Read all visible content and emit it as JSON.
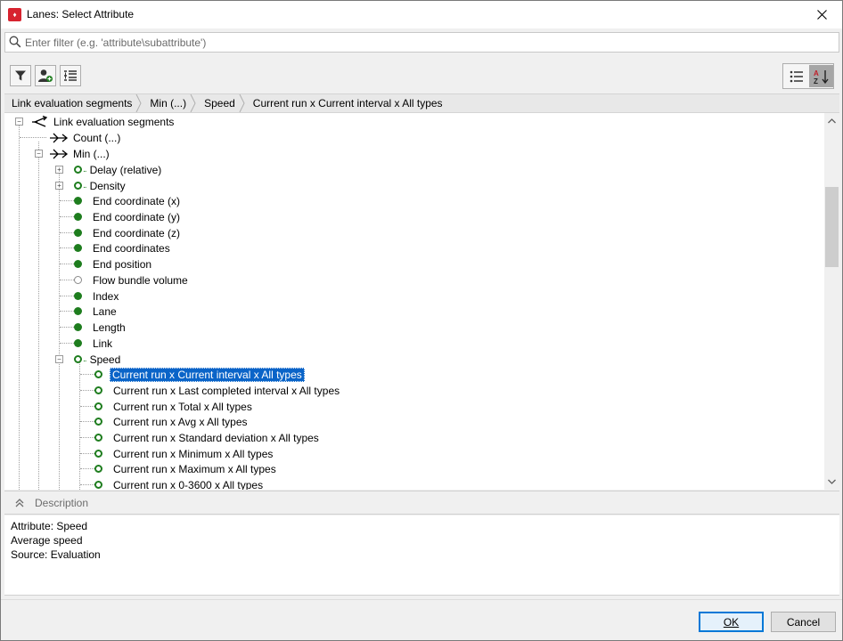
{
  "window": {
    "title": "Lanes: Select Attribute"
  },
  "filter": {
    "placeholder": "Enter filter (e.g. 'attribute\\subattribute')",
    "value": ""
  },
  "breadcrumb": [
    "Link evaluation segments",
    "Min (...)",
    "Speed",
    "Current run x Current interval x All types"
  ],
  "tree": {
    "root": "Link evaluation segments",
    "count": "Count (...)",
    "min": "Min (...)",
    "attributes": [
      {
        "label": "Delay (relative)",
        "icon": "ring-dots",
        "expandable": true
      },
      {
        "label": "Density",
        "icon": "ring-dots",
        "expandable": true
      },
      {
        "label": "End coordinate (x)",
        "icon": "filled"
      },
      {
        "label": "End coordinate (y)",
        "icon": "filled"
      },
      {
        "label": "End coordinate (z)",
        "icon": "filled"
      },
      {
        "label": "End coordinates",
        "icon": "filled"
      },
      {
        "label": "End position",
        "icon": "filled"
      },
      {
        "label": "Flow bundle volume",
        "icon": "ring-gray"
      },
      {
        "label": "Index",
        "icon": "filled"
      },
      {
        "label": "Lane",
        "icon": "filled"
      },
      {
        "label": "Length",
        "icon": "filled"
      },
      {
        "label": "Link",
        "icon": "filled"
      },
      {
        "label": "Speed",
        "icon": "ring-dots",
        "expanded": true
      }
    ],
    "speed_children": [
      {
        "label": "Current run x Current interval x All types",
        "selected": true
      },
      {
        "label": "Current run x Last completed interval x All types"
      },
      {
        "label": "Current run x Total x All types"
      },
      {
        "label": "Current run x Avg x All types"
      },
      {
        "label": "Current run x Standard deviation x All types"
      },
      {
        "label": "Current run x Minimum x All types"
      },
      {
        "label": "Current run x Maximum x All types"
      },
      {
        "label": "Current run x 0-3600 x All types"
      }
    ]
  },
  "description": {
    "header": "Description",
    "lines": [
      "Attribute: Speed",
      "Average speed",
      "Source: Evaluation"
    ]
  },
  "buttons": {
    "ok": "OK",
    "cancel": "Cancel"
  },
  "colors": {
    "accent": "#0078d7",
    "selection": "#0a64c8",
    "attr_green": "#1e7d1e",
    "brand_red": "#d7232f"
  }
}
